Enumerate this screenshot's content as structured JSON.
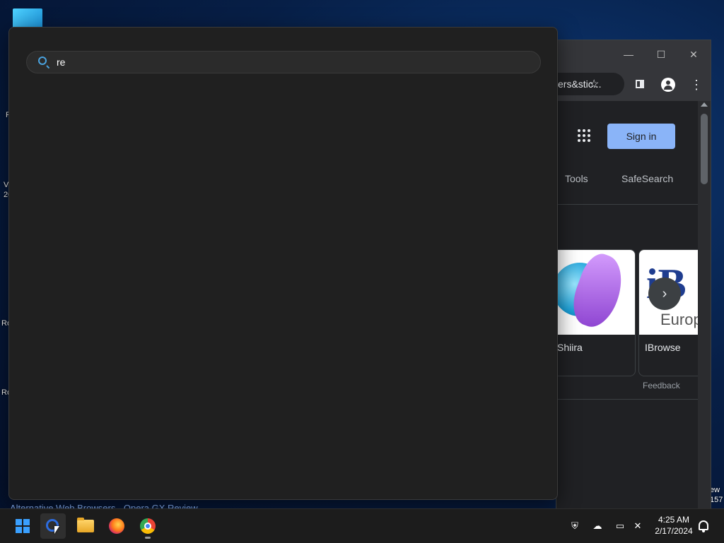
{
  "desktop": {
    "fragments": [
      "F",
      "V",
      "20",
      "Ro",
      "Ro",
      "ew",
      "157"
    ]
  },
  "chrome_window": {
    "minimize_glyph": "—",
    "maximize_glyph": "☐",
    "close_glyph": "✕",
    "omnibox_text": "ers&stic...",
    "star_glyph": "☆",
    "kebab_glyph": "⋮",
    "sign_in_label": "Sign in",
    "tools_label": "Tools",
    "safesearch_label": "SafeSearch",
    "cards": [
      {
        "name": "Shiira"
      },
      {
        "name": "IBrowse"
      }
    ],
    "carousel_next_glyph": "›",
    "feedback_label": "Feedback",
    "background_link_text": "Alternative Web Browsers - Opera GX Review"
  },
  "launcher": {
    "search_value": "re",
    "accent": "#4aa3df"
  },
  "taskbar": {
    "items": [
      "start-icon",
      "search-icon",
      "file-explorer-icon",
      "firefox-icon",
      "chrome-icon"
    ],
    "time": "4:25 AM",
    "date": "2/17/2024"
  },
  "colors": {
    "launcher_bg": "#202020",
    "chrome_bg": "#202124",
    "sign_in_bg": "#8ab4f8",
    "taskbar_bg": "#1c1c1c"
  }
}
